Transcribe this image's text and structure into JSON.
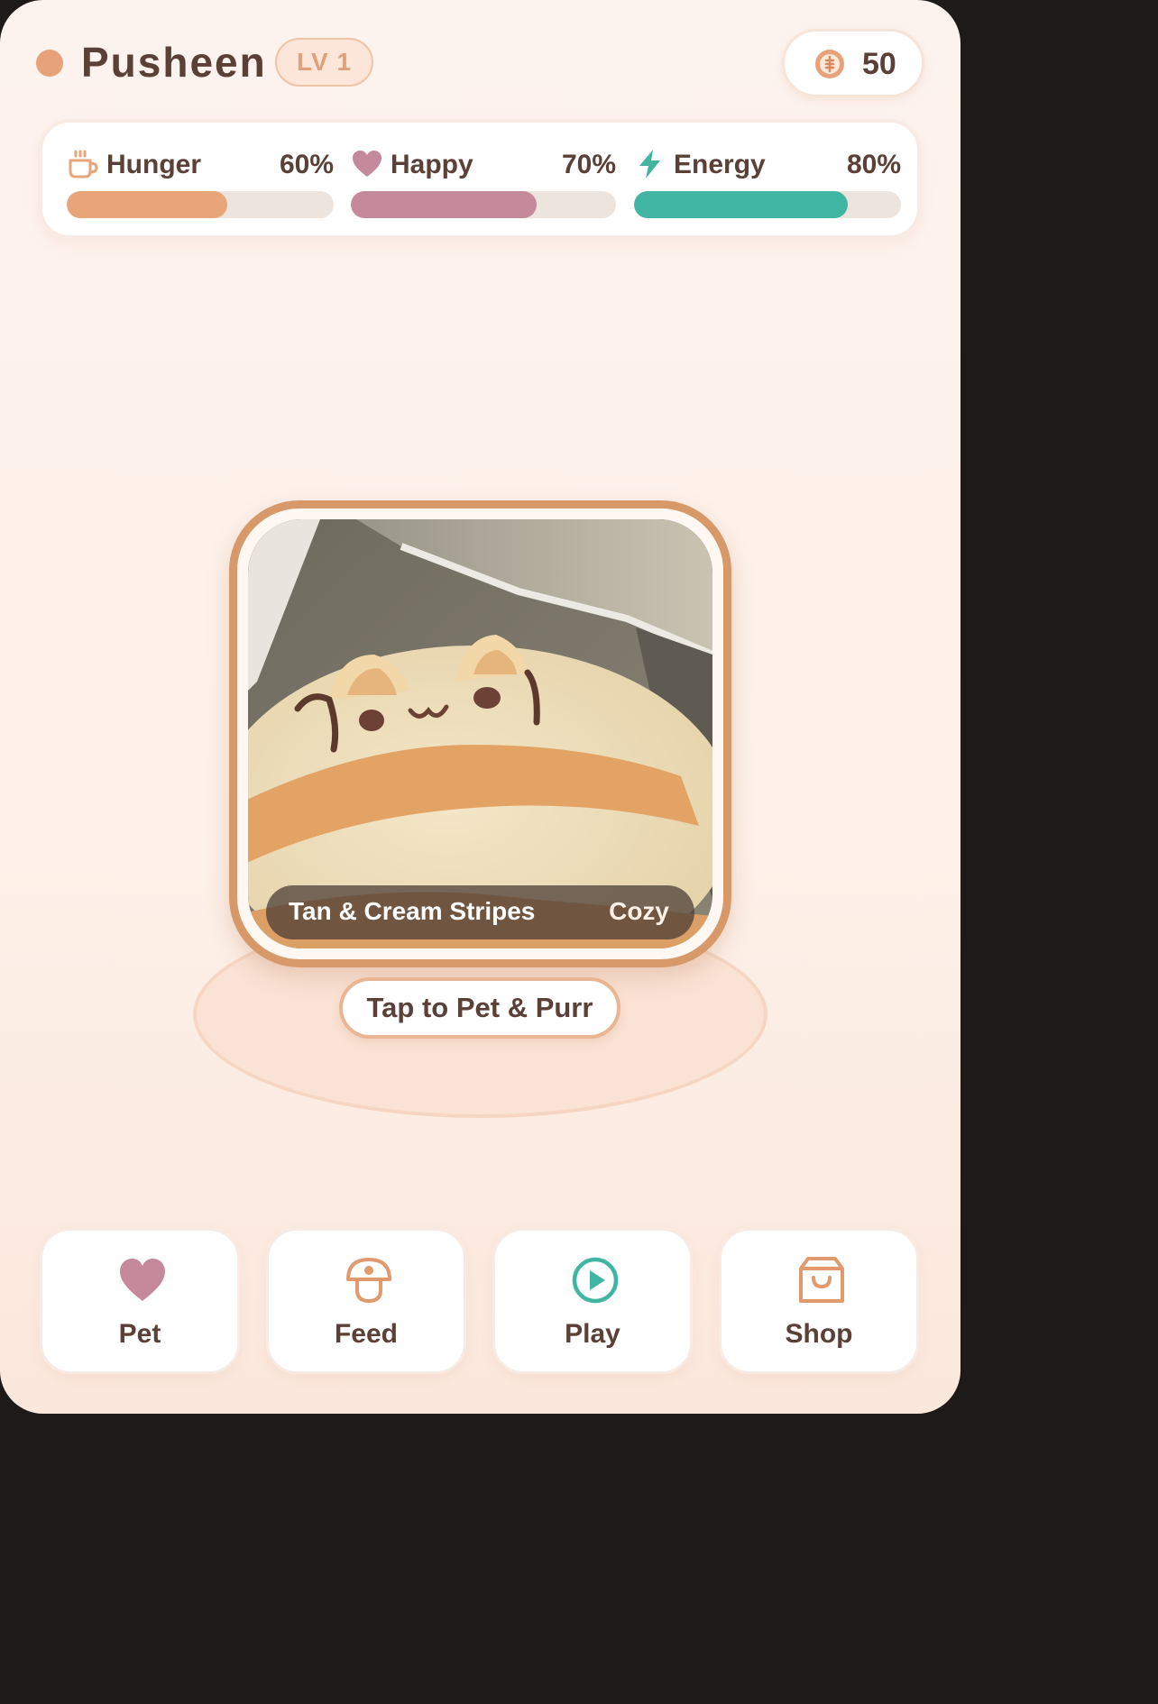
{
  "header": {
    "pet_name": "Pusheen",
    "level": "LV 1",
    "coins": "50"
  },
  "stats": [
    {
      "label": "Hunger",
      "value": "60%",
      "level": 0.6,
      "color": "#e9a57a",
      "icon": "cup-icon"
    },
    {
      "label": "Happy",
      "value": "70%",
      "level": 0.7,
      "color": "#c48a9b",
      "icon": "heart-icon"
    },
    {
      "label": "Energy",
      "value": "80%",
      "level": 0.8,
      "color": "#3fb5a2",
      "icon": "lightning-icon"
    }
  ],
  "pet_photo": {
    "name": "Tan & Cream Stripes",
    "mood": "Cozy"
  },
  "pet_action_button": "Tap to Pet & Purr",
  "actions": [
    {
      "label": "Pet",
      "icon": "heart-icon",
      "color": "#c48a9b"
    },
    {
      "label": "Feed",
      "icon": "food-bowl-icon",
      "color": "#e09a6e"
    },
    {
      "label": "Play",
      "icon": "play-icon",
      "color": "#3fb5a2"
    },
    {
      "label": "Shop",
      "icon": "shopping-bag-icon",
      "color": "#e09a6e"
    }
  ]
}
